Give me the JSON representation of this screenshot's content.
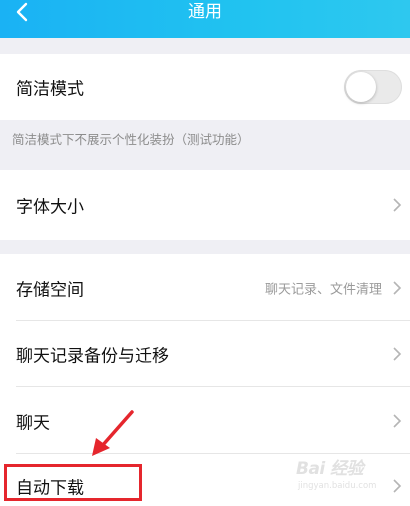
{
  "header": {
    "title": "通用",
    "back_icon": "chevron-left-icon",
    "background_color": "#1ab2f4"
  },
  "simple_mode": {
    "label": "简洁模式",
    "enabled": false,
    "hint": "简洁模式下不展示个性化装扮（测试功能）"
  },
  "font_size": {
    "label": "字体大小"
  },
  "storage": {
    "label": "存储空间",
    "value": "聊天记录、文件清理"
  },
  "chat_backup": {
    "label": "聊天记录备份与迁移"
  },
  "chat": {
    "label": "聊天"
  },
  "auto_download": {
    "label": "自动下载"
  },
  "annotation": {
    "highlight_color": "#e5262d"
  },
  "watermark": {
    "logo": "Bai 经验",
    "url": "jingyan.baidu.com"
  }
}
